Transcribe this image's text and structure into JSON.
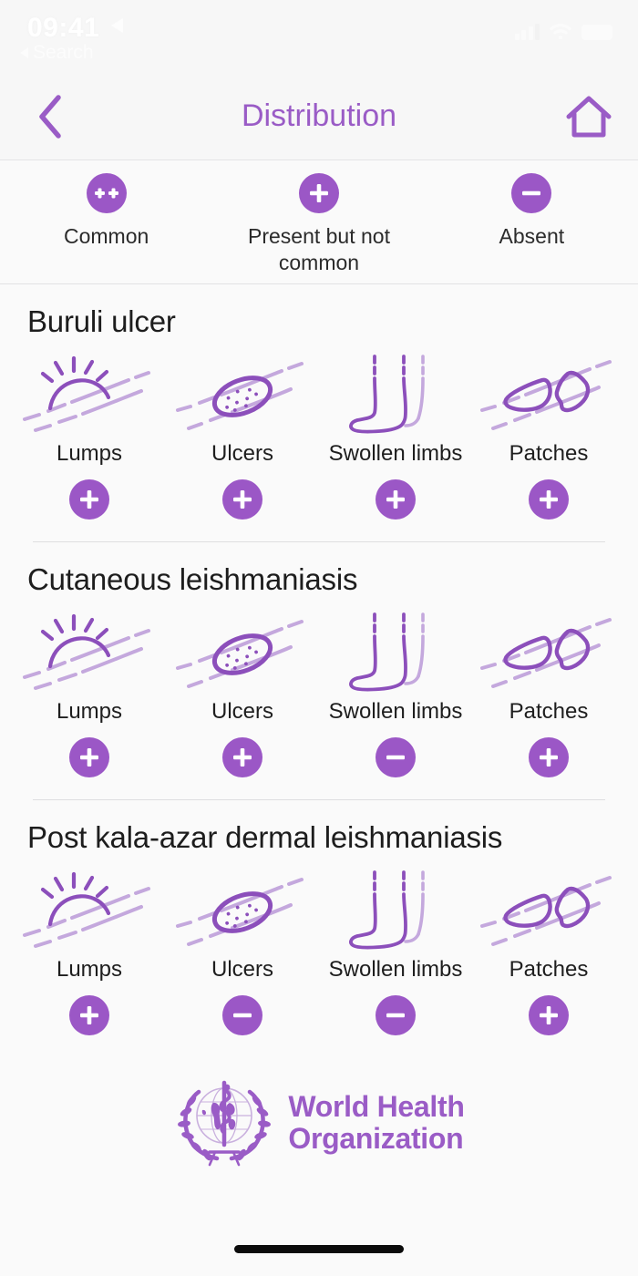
{
  "statusbar": {
    "time": "09:41",
    "back_app_label": "Search",
    "location_icon": "location-arrow-icon",
    "cellular_icon": "cellular-signal-icon",
    "wifi_icon": "wifi-icon",
    "battery_icon": "battery-icon"
  },
  "navbar": {
    "back_icon": "chevron-left-icon",
    "title": "Distribution",
    "home_icon": "home-icon"
  },
  "legend": {
    "items": [
      {
        "symbol": "++",
        "label": "Common",
        "icon": "double-plus-badge-icon"
      },
      {
        "symbol": "+",
        "label": "Present but not common",
        "icon": "plus-badge-icon"
      },
      {
        "symbol": "-",
        "label": "Absent",
        "icon": "minus-badge-icon"
      }
    ]
  },
  "diseases": [
    {
      "name": "Buruli ulcer",
      "symptoms": [
        {
          "label": "Lumps",
          "icon": "lumps-icon",
          "value": "+"
        },
        {
          "label": "Ulcers",
          "icon": "ulcers-icon",
          "value": "+"
        },
        {
          "label": "Swollen limbs",
          "icon": "swollen-limbs-icon",
          "value": "+"
        },
        {
          "label": "Patches",
          "icon": "patches-icon",
          "value": "+"
        }
      ]
    },
    {
      "name": "Cutaneous leishmaniasis",
      "symptoms": [
        {
          "label": "Lumps",
          "icon": "lumps-icon",
          "value": "+"
        },
        {
          "label": "Ulcers",
          "icon": "ulcers-icon",
          "value": "+"
        },
        {
          "label": "Swollen limbs",
          "icon": "swollen-limbs-icon",
          "value": "-"
        },
        {
          "label": "Patches",
          "icon": "patches-icon",
          "value": "+"
        }
      ]
    },
    {
      "name": "Post kala-azar dermal leishmaniasis",
      "symptoms": [
        {
          "label": "Lumps",
          "icon": "lumps-icon",
          "value": "+"
        },
        {
          "label": "Ulcers",
          "icon": "ulcers-icon",
          "value": "-"
        },
        {
          "label": "Swollen limbs",
          "icon": "swollen-limbs-icon",
          "value": "-"
        },
        {
          "label": "Patches",
          "icon": "patches-icon",
          "value": "+"
        }
      ]
    }
  ],
  "footer": {
    "logo_icon": "who-emblem-icon",
    "line1": "World Health",
    "line2": "Organization"
  },
  "colors": {
    "accent_purple": "#9a5cc6",
    "badge_purple": "#9b57c6",
    "icon_light_purple": "#c4a8dd",
    "page_background": "#fafafa",
    "header_background": "#f7f7f7",
    "text_dark": "#1d1d1d"
  }
}
